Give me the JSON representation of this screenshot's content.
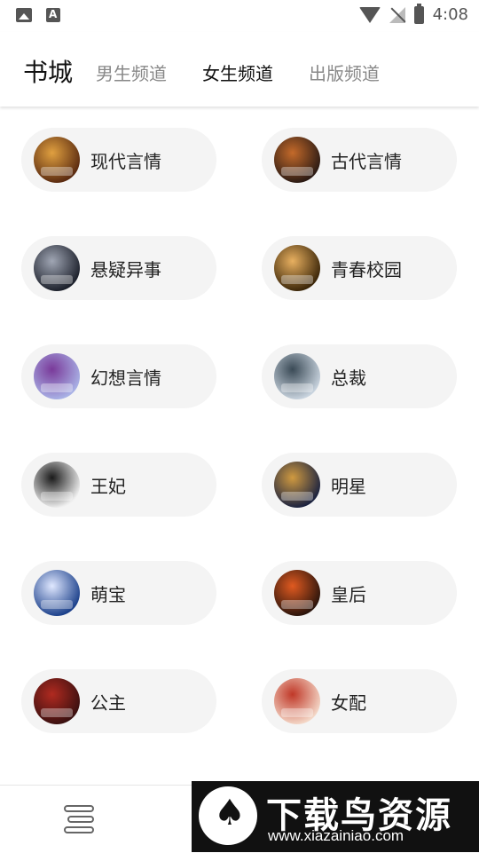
{
  "status_bar": {
    "time": "4:08"
  },
  "header": {
    "title": "书城",
    "tabs": [
      {
        "label": "男生频道",
        "active": false
      },
      {
        "label": "女生频道",
        "active": true
      },
      {
        "label": "出版频道",
        "active": false
      }
    ]
  },
  "categories": [
    {
      "label": "现代言情",
      "cover_colors": [
        "#5a2a10",
        "#e0a040"
      ]
    },
    {
      "label": "古代言情",
      "cover_colors": [
        "#2a1a14",
        "#c46a2a"
      ]
    },
    {
      "label": "悬疑异事",
      "cover_colors": [
        "#1b1f2a",
        "#a0a6b4"
      ]
    },
    {
      "label": "青春校园",
      "cover_colors": [
        "#3a2508",
        "#e8b060"
      ]
    },
    {
      "label": "幻想言情",
      "cover_colors": [
        "#a9b2e6",
        "#7a3a9a"
      ]
    },
    {
      "label": "总裁",
      "cover_colors": [
        "#c9d4df",
        "#3a4a56"
      ]
    },
    {
      "label": "王妃",
      "cover_colors": [
        "#f0f0f0",
        "#1a1a1a"
      ]
    },
    {
      "label": "明星",
      "cover_colors": [
        "#1a2240",
        "#d09a40"
      ]
    },
    {
      "label": "萌宝",
      "cover_colors": [
        "#1a3f8a",
        "#e0e8ff"
      ]
    },
    {
      "label": "皇后",
      "cover_colors": [
        "#2a140c",
        "#e05a20"
      ]
    },
    {
      "label": "公主",
      "cover_colors": [
        "#3a1010",
        "#b02a20"
      ]
    },
    {
      "label": "女配",
      "cover_colors": [
        "#f4d8c8",
        "#c03828"
      ]
    }
  ],
  "watermark": {
    "name": "下载鸟资源",
    "url": "www.xiazainiao.com"
  }
}
